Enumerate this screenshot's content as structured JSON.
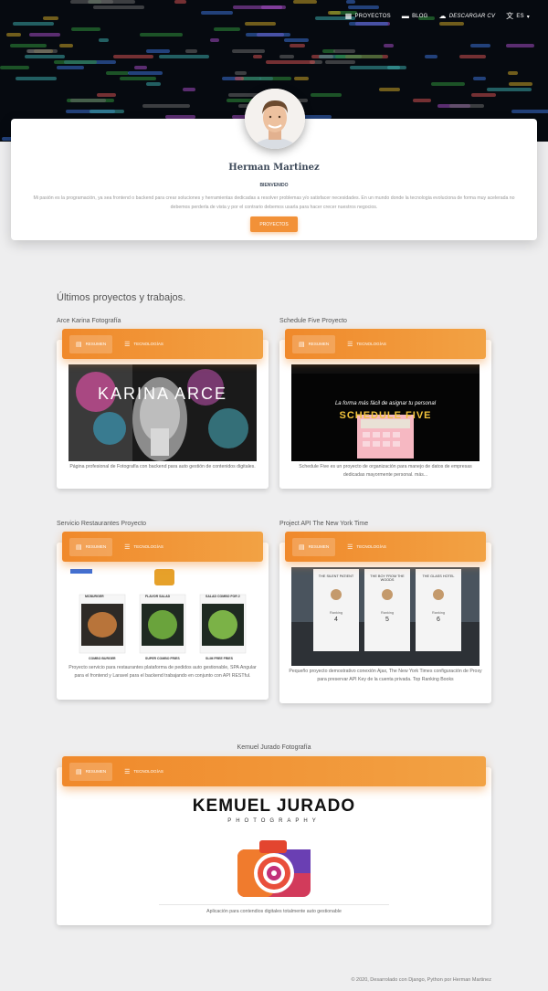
{
  "nav": {
    "items": [
      {
        "label": "PROYECTOS",
        "icon": "grid-icon"
      },
      {
        "label": "BLOG",
        "icon": "folder-icon"
      },
      {
        "label": "DESCARGAR CV",
        "icon": "cloud-download-icon"
      },
      {
        "label": "ES",
        "icon": "translate-icon"
      }
    ]
  },
  "profile": {
    "name": "Herman Martinez",
    "welcome": "BIENVENIDO",
    "bio": "Mi pasión es la programación, ya sea frontend o backend para crear soluciones y herramientas dedicadas a resolver problemas y/o satisfacer necesidades. En un mundo donde la tecnologia evoluciona de forma muy acelerada no debemos perderla de vista y por el contrario debemos usarla para hacer crecer nuestros negocios.",
    "button": "PROYECTOS"
  },
  "section_title": "Últimos proyectos y trabajos.",
  "tabs": {
    "summary": "RESUMEN",
    "tech": "TECNOLOGÍAS"
  },
  "projects": [
    {
      "title": "Arce Karina Fotografía",
      "thumb_text": "KARINA ARCE",
      "description": "Página profesional de Fotografía con backend para auto gestión de contenidos digitales."
    },
    {
      "title": "Schedule Five Proyecto",
      "thumb_text": "SCHEDULE FIVE",
      "thumb_subtitle": "La forma más fácil de asignar tu personal",
      "description": "Schedule Five es un proyecto de organización para manejo de datos de empresas dedicadas mayormente personal. más..."
    },
    {
      "title": "Servicio Restaurantes Proyecto",
      "thumb_items": [
        "MCBURGER",
        "FLAVOR SALAD",
        "SALAD COMBO FOR 2"
      ],
      "thumb_bottom": [
        "COMBO BURGER",
        "SUPER COMBO FRIES",
        "SLIM FREE FRIES"
      ],
      "description": "Proyecto servicio para restaurantes plataforma de pedidos auto gestionable, SPA Angular para el frontend y Laravel para el backend trabajando en conjunto con API RESTful."
    },
    {
      "title": "Project API The New York Time",
      "thumb_items": [
        "THE SILENT PATIENT",
        "THE BOY FROM THE WOODS",
        "THE GLASS HOTEL"
      ],
      "thumb_ranks": [
        "4",
        "5",
        "6"
      ],
      "thumb_label": "Ranking",
      "description": "Pequeño proyecto demostrativo conexión Ajax, The New York Times configuración de Proxy para preservar API Key de la cuenta privada. Top Ranking Books"
    },
    {
      "title": "Kemuel Jurado Fotografía",
      "thumb_text": "KEMUEL JURADO",
      "thumb_subtitle": "PHOTOGRAPHY",
      "description": "Aplicación para contendios digitales totalmente auto gestionable"
    }
  ],
  "footer": "© 2020, Desarrolado con Django, Python por Herman Martinez",
  "colors": {
    "accent": "#f29138",
    "background": "#eeeeef",
    "hero": "#060a10"
  }
}
